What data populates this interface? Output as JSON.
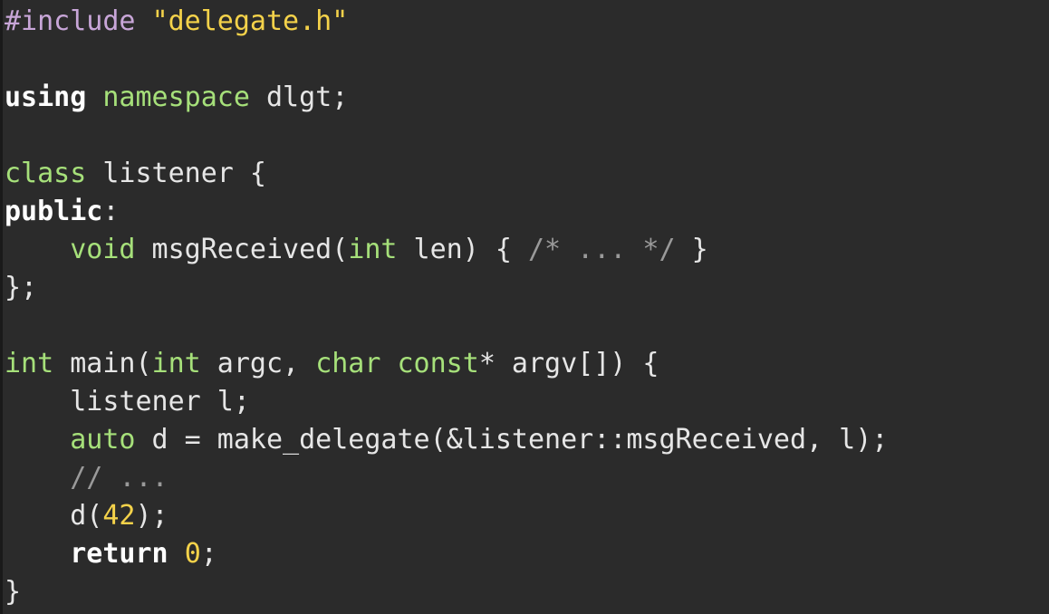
{
  "colors": {
    "background": "#2b2b2b",
    "plain": "#e6e6e6",
    "preprocessor": "#c8a6d8",
    "string": "#f4d24a",
    "keyword_bold": "#ffffff",
    "keyword": "#a6e07a",
    "comment": "#9a9a9a",
    "number": "#f4d24a"
  },
  "lines": [
    [
      [
        "pre",
        "#include"
      ],
      [
        "plain",
        " "
      ],
      [
        "str",
        "\"delegate.h\""
      ]
    ],
    [],
    [
      [
        "kw-bold",
        "using"
      ],
      [
        "plain",
        " "
      ],
      [
        "kw",
        "namespace"
      ],
      [
        "plain",
        " dlgt;"
      ]
    ],
    [],
    [
      [
        "kw",
        "class"
      ],
      [
        "plain",
        " listener {"
      ]
    ],
    [
      [
        "kw-bold",
        "public"
      ],
      [
        "plain",
        ":"
      ]
    ],
    [
      [
        "plain",
        "    "
      ],
      [
        "type",
        "void"
      ],
      [
        "plain",
        " msgReceived("
      ],
      [
        "type",
        "int"
      ],
      [
        "plain",
        " len) { "
      ],
      [
        "comment",
        "/* ... */"
      ],
      [
        "plain",
        " }"
      ]
    ],
    [
      [
        "plain",
        "};"
      ]
    ],
    [],
    [
      [
        "type",
        "int"
      ],
      [
        "plain",
        " main("
      ],
      [
        "type",
        "int"
      ],
      [
        "plain",
        " argc, "
      ],
      [
        "type",
        "char"
      ],
      [
        "plain",
        " "
      ],
      [
        "kw",
        "const"
      ],
      [
        "plain",
        "* argv[]) {"
      ]
    ],
    [
      [
        "plain",
        "    listener l;"
      ]
    ],
    [
      [
        "plain",
        "    "
      ],
      [
        "kw",
        "auto"
      ],
      [
        "plain",
        " d = make_delegate(&listener::msgReceived, l);"
      ]
    ],
    [
      [
        "plain",
        "    "
      ],
      [
        "comment",
        "// ..."
      ]
    ],
    [
      [
        "plain",
        "    d("
      ],
      [
        "num",
        "42"
      ],
      [
        "plain",
        ");"
      ]
    ],
    [
      [
        "plain",
        "    "
      ],
      [
        "kw-bold",
        "return"
      ],
      [
        "plain",
        " "
      ],
      [
        "num",
        "0"
      ],
      [
        "plain",
        ";"
      ]
    ],
    [
      [
        "plain",
        "}"
      ]
    ]
  ]
}
